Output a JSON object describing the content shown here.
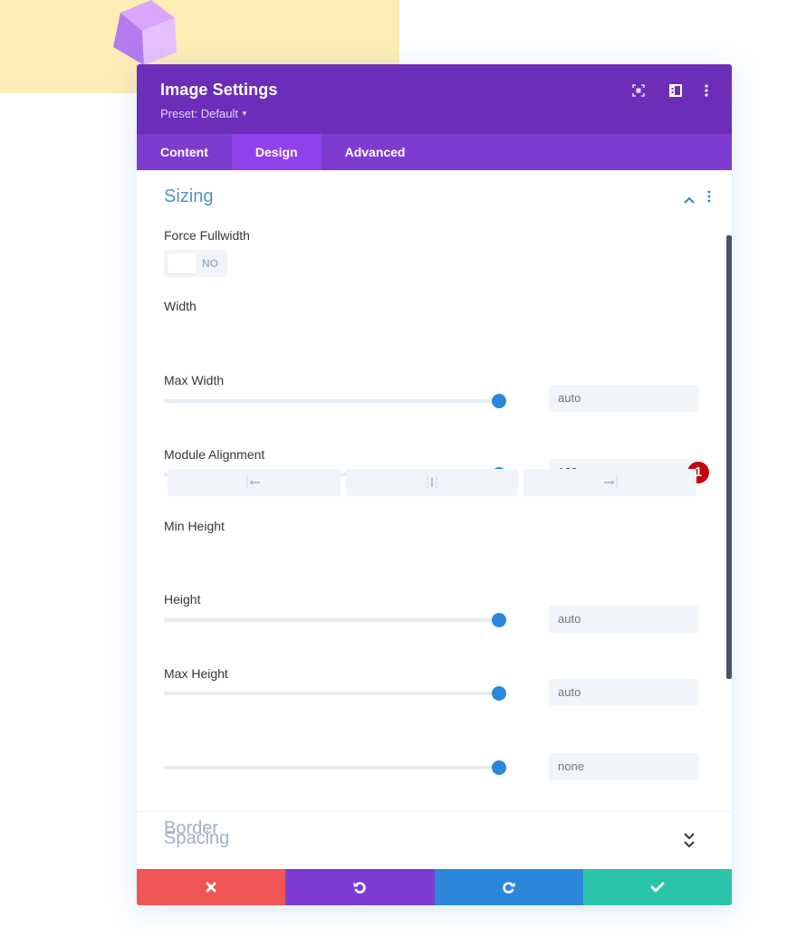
{
  "background": {
    "accent_color": "#feecb7",
    "cube_color": "#c58af5"
  },
  "modal": {
    "title": "Image Settings",
    "preset_label": "Preset: Default",
    "header_icons": [
      "expand-icon",
      "sidebar-layout-icon",
      "more-vertical-icon"
    ],
    "colors": {
      "header": "#6c2eb9",
      "tabs": "#7e3bd0",
      "active_tab": "#8f42ec"
    }
  },
  "tabs": [
    {
      "label": "Content",
      "active": false
    },
    {
      "label": "Design",
      "active": true
    },
    {
      "label": "Advanced",
      "active": false
    }
  ],
  "sizing": {
    "title": "Sizing",
    "expanded": true,
    "force_fullwidth": {
      "label": "Force Fullwidth",
      "value": "NO"
    },
    "width": {
      "label": "Width",
      "value": "",
      "placeholder": "auto",
      "slider_percent": 100
    },
    "max_width": {
      "label": "Max Width",
      "value": "100px",
      "placeholder": "",
      "slider_percent": 100,
      "badge": "1"
    },
    "module_alignment": {
      "label": "Module Alignment",
      "options": [
        "left",
        "center",
        "right"
      ]
    },
    "min_height": {
      "label": "Min Height",
      "value": "",
      "placeholder": "auto",
      "slider_percent": 100
    },
    "height": {
      "label": "Height",
      "value": "",
      "placeholder": "auto",
      "slider_percent": 100
    },
    "max_height": {
      "label": "Max Height",
      "value": "",
      "placeholder": "none",
      "slider_percent": 100
    }
  },
  "collapsed_sections": [
    {
      "title": "Spacing"
    },
    {
      "title": "Border"
    }
  ],
  "footer": {
    "buttons": [
      {
        "name": "cancel",
        "icon": "close-icon",
        "color": "#ef5555"
      },
      {
        "name": "undo",
        "icon": "undo-icon",
        "color": "#7e3bd0"
      },
      {
        "name": "redo",
        "icon": "redo-icon",
        "color": "#2b87da"
      },
      {
        "name": "save",
        "icon": "check-icon",
        "color": "#29c4a9"
      }
    ]
  }
}
